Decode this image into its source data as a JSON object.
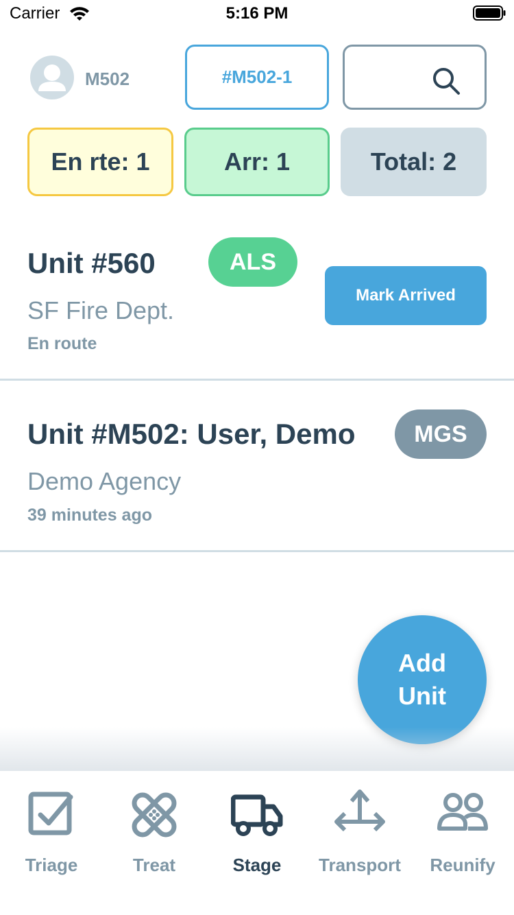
{
  "status_bar": {
    "carrier": "Carrier",
    "time": "5:16 PM"
  },
  "header": {
    "user_id": "M502",
    "incident_label": "#M502-1",
    "search_placeholder": ""
  },
  "summary": {
    "enroute": "En rte: 1",
    "arrived": "Arr: 1",
    "total": "Total: 2"
  },
  "units": [
    {
      "title": "Unit #560",
      "agency": "SF Fire Dept.",
      "status": "En route",
      "badge": "ALS",
      "action_label": "Mark Arrived"
    },
    {
      "title": "Unit #M502: User, Demo",
      "agency": "Demo Agency",
      "status": "39 minutes ago",
      "badge": "MGS"
    }
  ],
  "fab": {
    "line1": "Add",
    "line2": "Unit"
  },
  "tabs": [
    {
      "label": "Triage",
      "icon": "checkbox-icon"
    },
    {
      "label": "Treat",
      "icon": "bandage-icon"
    },
    {
      "label": "Stage",
      "icon": "truck-icon",
      "active": true
    },
    {
      "label": "Transport",
      "icon": "arrows-icon"
    },
    {
      "label": "Reunify",
      "icon": "people-icon"
    }
  ],
  "colors": {
    "accent": "#48a6dc",
    "text_dark": "#2c4355",
    "text_muted": "#7f97a6",
    "als_green": "#57d193",
    "enroute_yellow": "#f5c842",
    "arrived_green": "#59cc8c"
  }
}
